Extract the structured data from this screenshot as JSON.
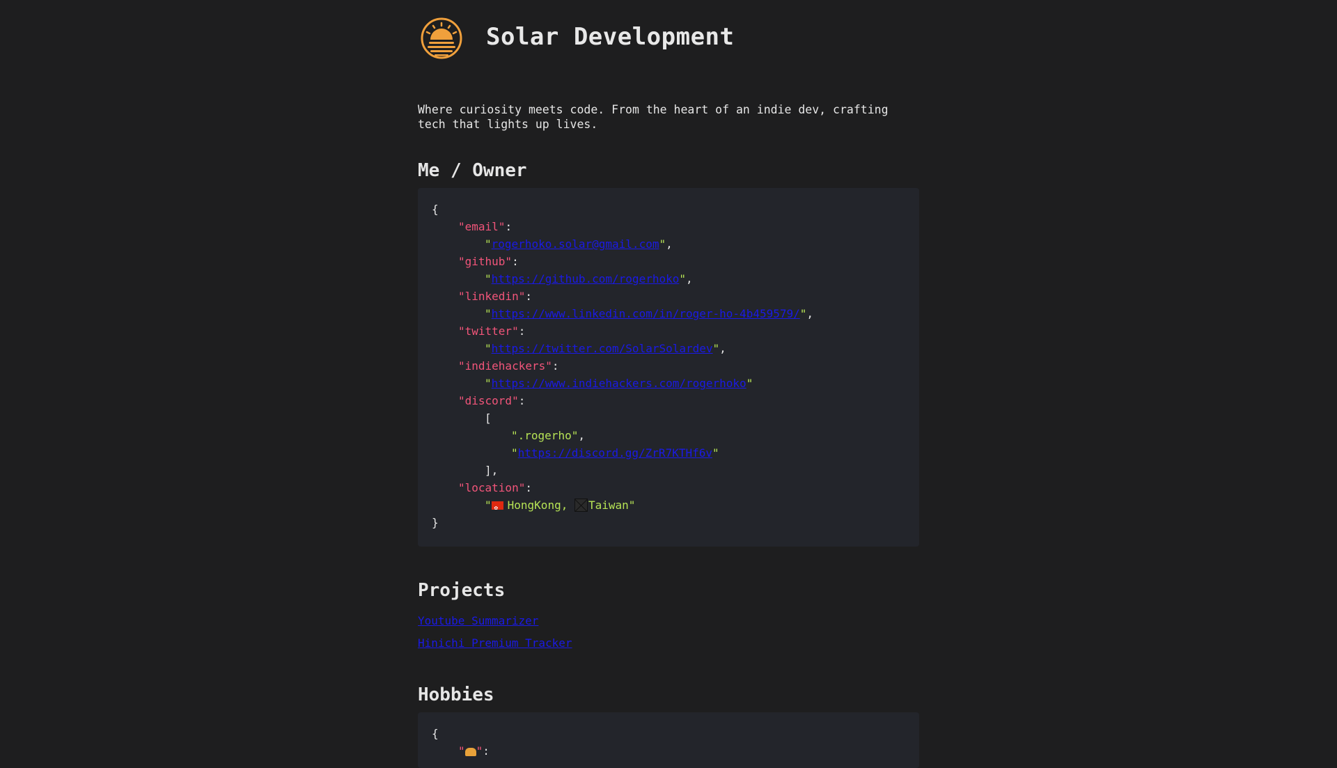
{
  "header": {
    "title": "Solar Development",
    "logo_icon": "sun-logo-icon"
  },
  "tagline": "Where curiosity meets code. From the heart of an indie dev, crafting tech that lights up lives.",
  "owner_section": {
    "heading": "Me / Owner",
    "email_key": "\"email\"",
    "email_value": "rogerhoko.solar@gmail.com",
    "github_key": "\"github\"",
    "github_value": "https://github.com/rogerhoko",
    "linkedin_key": "\"linkedin\"",
    "linkedin_value": "https://www.linkedin.com/in/roger-ho-4b459579/",
    "twitter_key": "\"twitter\"",
    "twitter_value": "https://twitter.com/SolarSolardev",
    "indiehackers_key": "\"indiehackers\"",
    "indiehackers_value": "https://www.indiehackers.com/rogerhoko",
    "discord_key": "\"discord\"",
    "discord_handle": ".rogerho",
    "discord_link": "https://discord.gg/ZrR7KTHf6v",
    "location_key": "\"location\"",
    "location_hk": "HongKong, ",
    "location_tw": "Taiwan"
  },
  "projects_section": {
    "heading": "Projects",
    "items": [
      {
        "label": "Youtube Summarizer"
      },
      {
        "label": "Hinichi Premium Tracker"
      }
    ]
  },
  "hobbies_section": {
    "heading": "Hobbies"
  },
  "colors": {
    "background": "#1e1e1f",
    "code_background": "#23252b",
    "key": "#f2557a",
    "string": "#b6e355",
    "link": "#1a1ae6",
    "logo": "#f0a03c"
  }
}
